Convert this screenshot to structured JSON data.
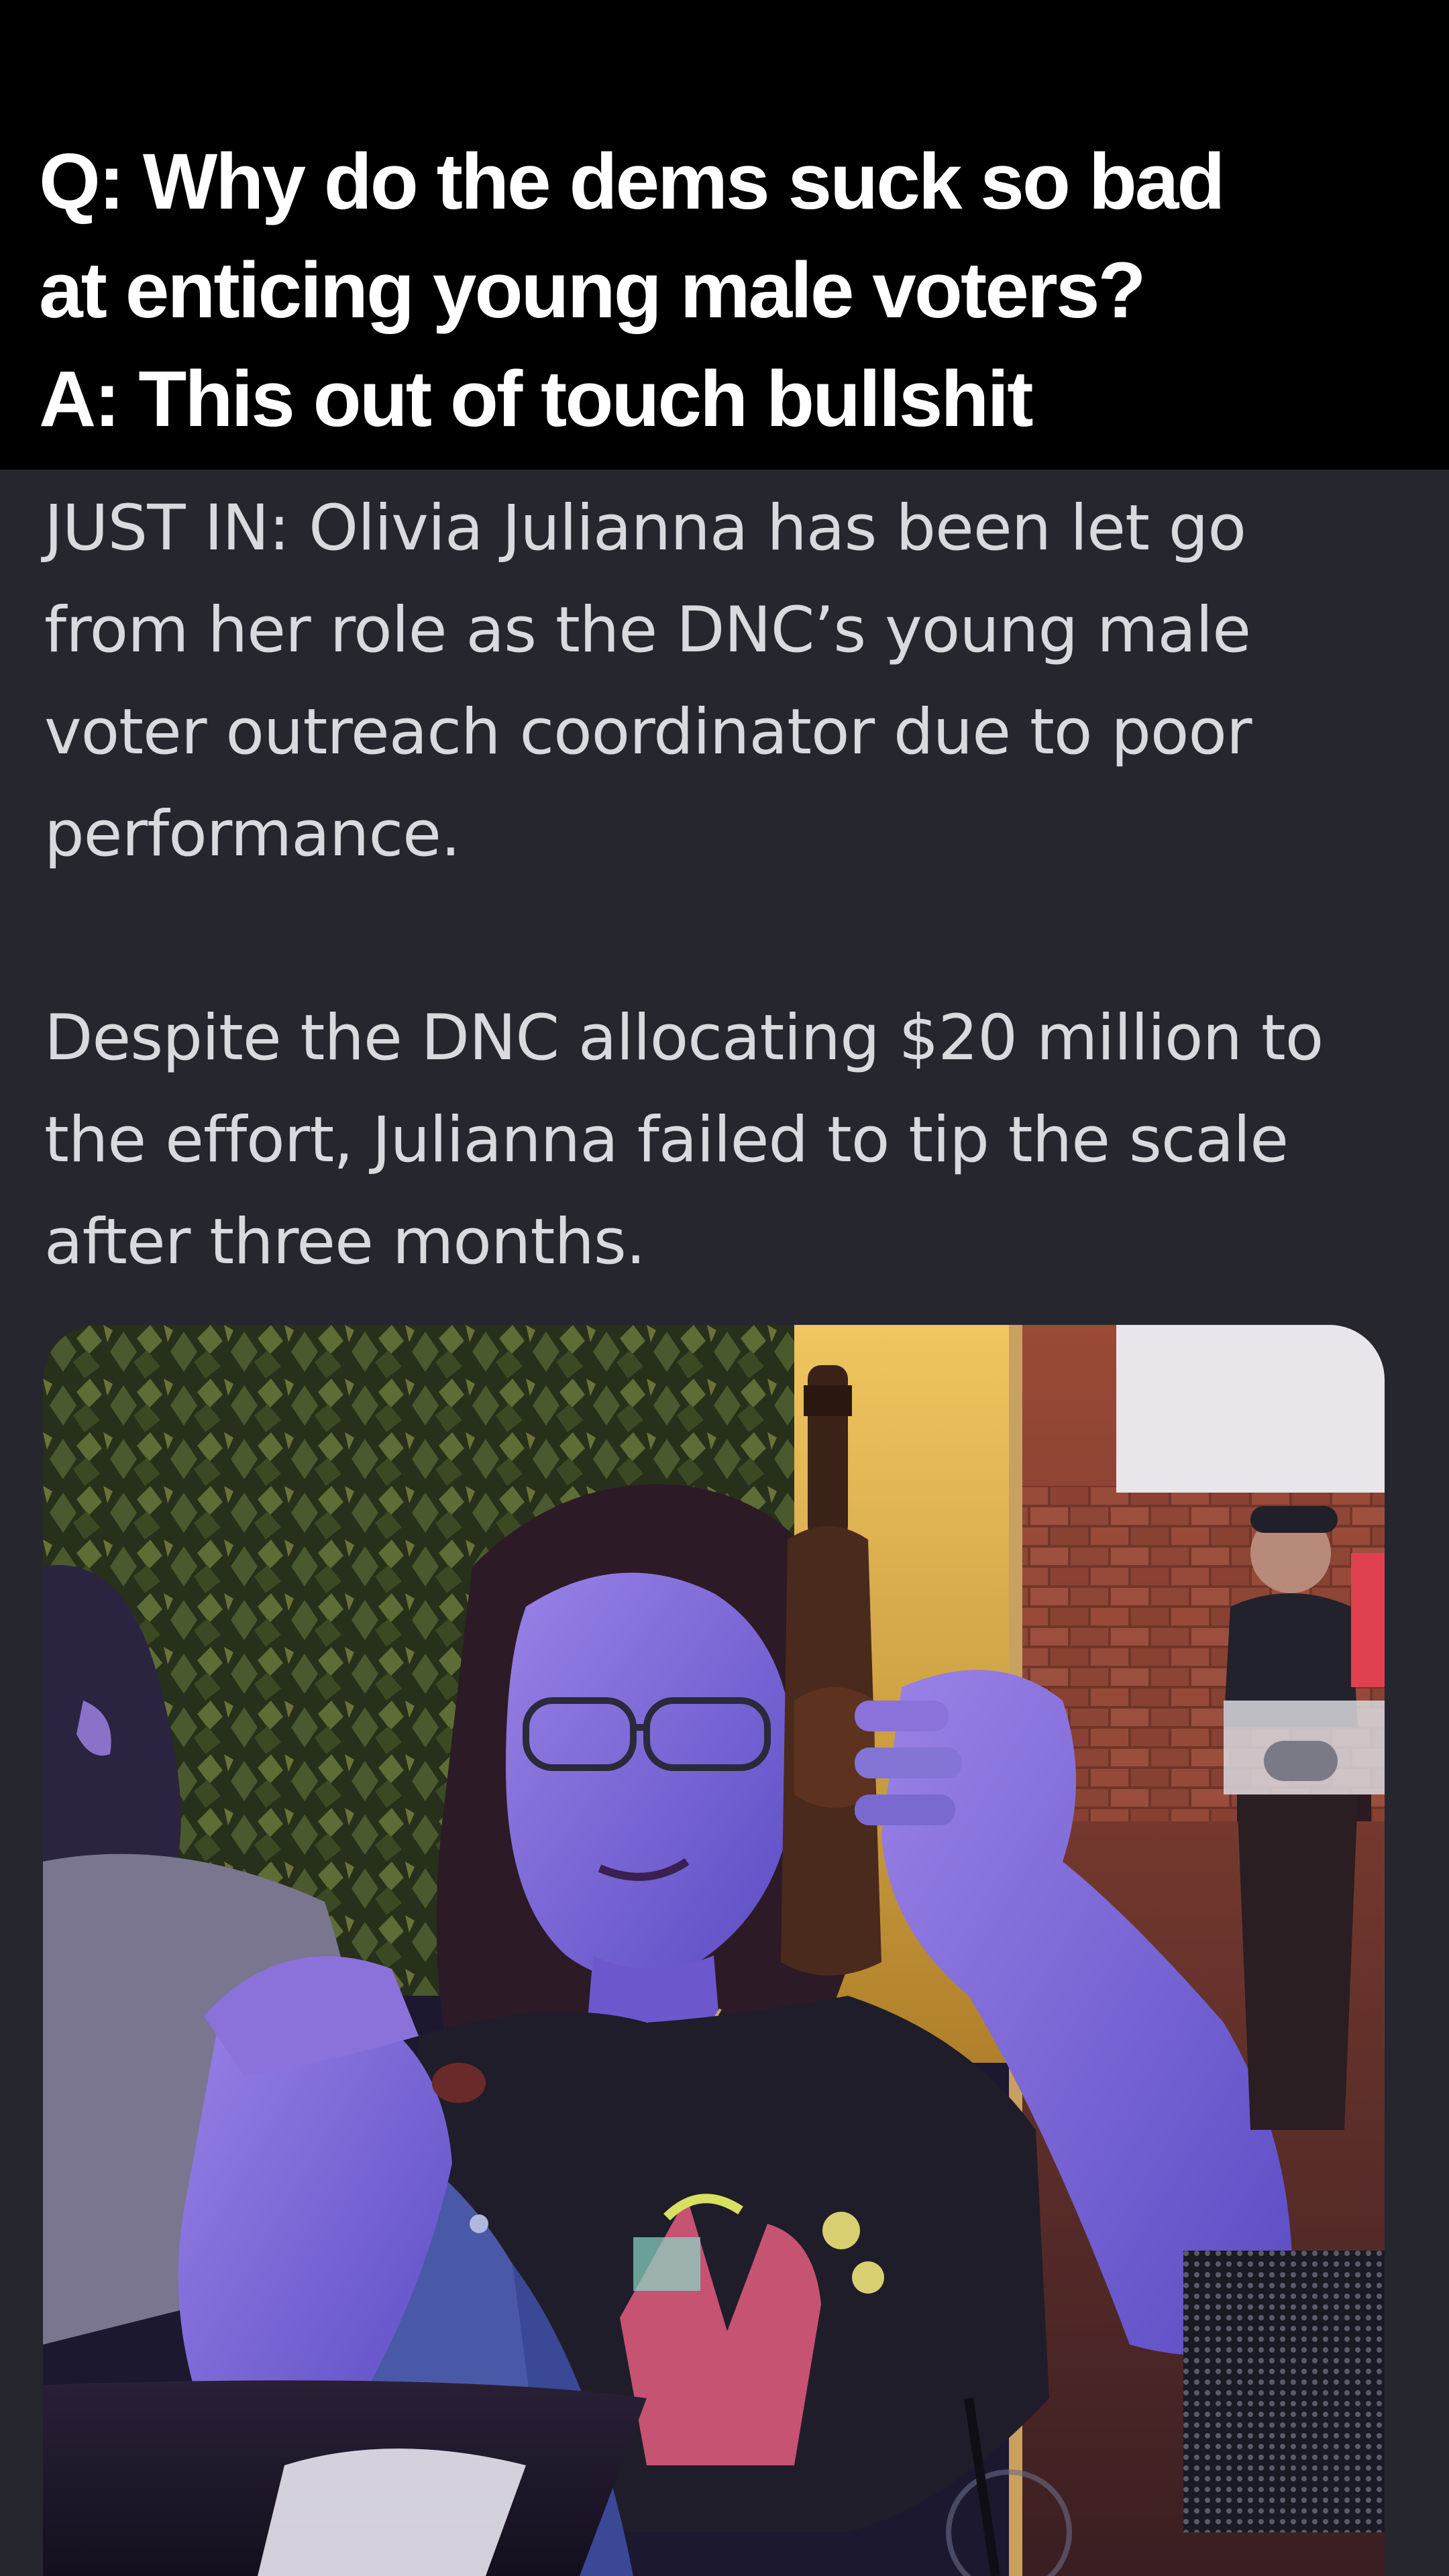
{
  "caption": {
    "lines": [
      "Q: Why do the dems suck so bad",
      "at enticing young male voters?",
      "A: This out of touch bullshit"
    ]
  },
  "post": {
    "paragraphs": [
      "JUST IN: Olivia Julianna has been let go\nfrom her role as the DNC’s young male\nvoter outreach coordinator due to poor\nperformance.",
      "Despite the DNC allocating $20 million to\nthe effort, Julianna failed to tip the scale\nafter three months."
    ]
  },
  "media": {
    "kind": "photo",
    "colors": {
      "foliage": "#3b4a2a",
      "wall": "#e6b84a",
      "brick": "#8a3c2c",
      "shirt": "#1e1e2a",
      "denim": "#4a5aa8",
      "skin_blue": "#7a6ad8",
      "bottle": "#3a2218"
    }
  }
}
